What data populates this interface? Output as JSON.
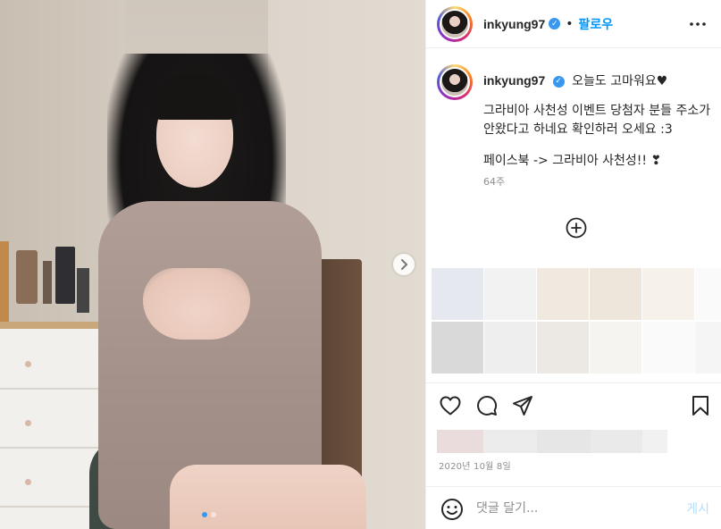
{
  "post": {
    "media": {
      "slide_count": 2,
      "active_slide": 1
    },
    "header": {
      "username": "inkyung97",
      "verified": true,
      "bullet": "•",
      "follow_label": "팔로우",
      "more_icon": "more-horizontal-icon"
    },
    "caption": {
      "username": "inkyung97",
      "line1": "오늘도 고마워요♥",
      "paragraph2": "그라비아 사천성 이벤트 당첨자 분들 주소가 안왔다고 하네요 확인하러 오세요 :3",
      "paragraph3": "페이스북 -> 그라비아 사천성!! ❣",
      "time_ago": "64주"
    },
    "actions": {
      "like_icon": "heart-icon",
      "comment_icon": "comment-icon",
      "share_icon": "share-icon",
      "save_icon": "bookmark-icon"
    },
    "date": "2020년 10월 8일",
    "comment_box": {
      "placeholder": "댓글 달기...",
      "post_label": "게시",
      "post_color": "#b2dffc"
    },
    "colors": {
      "accent": "#0095f6",
      "verified": "#3897f0",
      "muted": "#8e8e8e",
      "text": "#262626"
    }
  }
}
